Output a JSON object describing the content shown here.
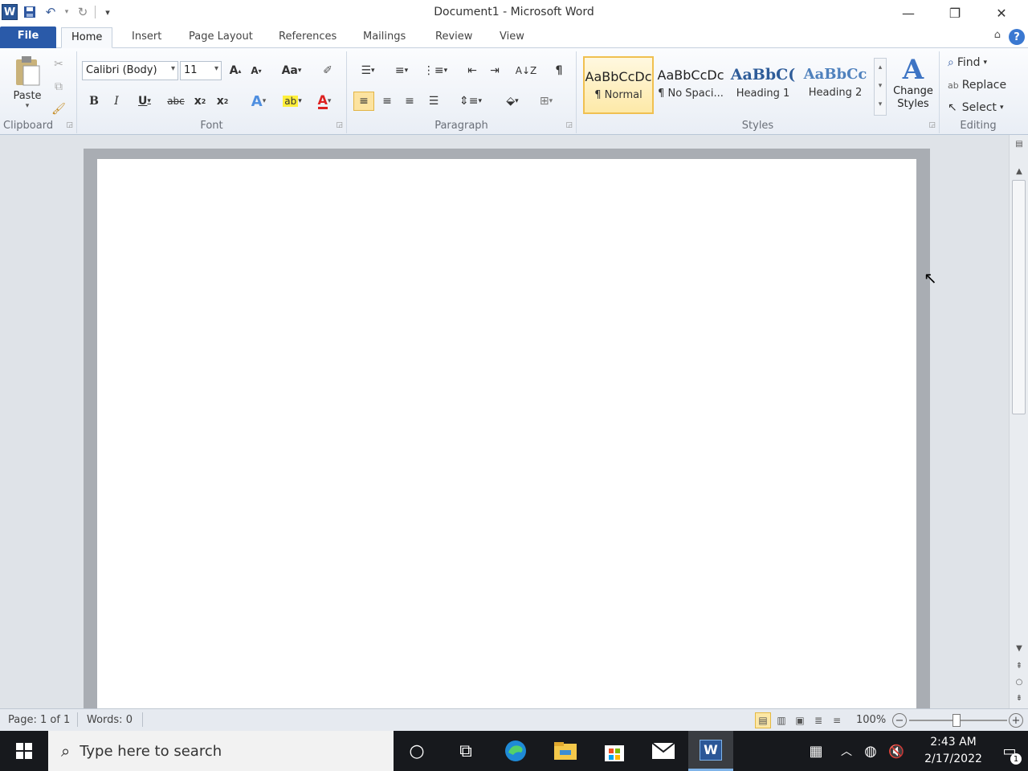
{
  "window": {
    "title": "Document1  -  Microsoft Word",
    "minimize": "—",
    "restore": "❐",
    "close": "✕"
  },
  "tabs": [
    "File",
    "Home",
    "Insert",
    "Page Layout",
    "References",
    "Mailings",
    "Review",
    "View"
  ],
  "active_tab": "Home",
  "ribbon": {
    "clipboard": {
      "label": "Clipboard",
      "paste": "Paste"
    },
    "font": {
      "label": "Font",
      "font_name": "Calibri (Body)",
      "font_size": "11"
    },
    "paragraph": {
      "label": "Paragraph"
    },
    "styles": {
      "label": "Styles",
      "items": [
        {
          "sample": "AaBbCcDc",
          "name": "¶ Normal",
          "color": "#222222"
        },
        {
          "sample": "AaBbCcDc",
          "name": "¶ No Spaci...",
          "color": "#222222"
        },
        {
          "sample": "AaBbC(",
          "name": "Heading 1",
          "color": "#2e5c99"
        },
        {
          "sample": "AaBbCc",
          "name": "Heading 2",
          "color": "#4f81bd"
        }
      ],
      "change_styles_line1": "Change",
      "change_styles_line2": "Styles"
    },
    "editing": {
      "label": "Editing",
      "find": "Find",
      "replace": "Replace",
      "select": "Select"
    }
  },
  "statusbar": {
    "page": "Page: 1 of 1",
    "words": "Words: 0",
    "zoom": "100%",
    "zoom_level": 100
  },
  "taskbar": {
    "search_placeholder": "Type here to search",
    "time": "2:43 AM",
    "date": "2/17/2022",
    "notification_count": "1"
  },
  "colors": {
    "file_tab": "#2a5aa9",
    "brand": "#2b5797",
    "selected_style": "#fde9a8"
  }
}
